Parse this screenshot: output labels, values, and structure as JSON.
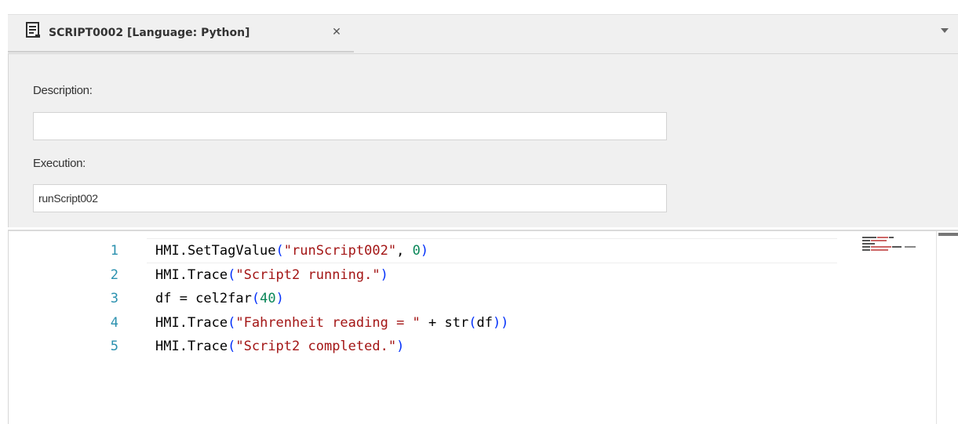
{
  "tab": {
    "title": "SCRIPT0002 [Language: Python]",
    "close_glyph": "✕",
    "icon": "script-document-icon",
    "dropdown_icon": "chevron-down-icon"
  },
  "properties": {
    "description_label": "Description:",
    "description_value": "",
    "execution_label": "Execution:",
    "execution_value": "runScript002"
  },
  "editor": {
    "lines": [
      {
        "number": "1",
        "tokens": [
          {
            "text": "HMI.SetTagValue",
            "kind": "plain"
          },
          {
            "text": "(",
            "kind": "bracket"
          },
          {
            "text": "\"runScript002\"",
            "kind": "str"
          },
          {
            "text": ", ",
            "kind": "plain"
          },
          {
            "text": "0",
            "kind": "num"
          },
          {
            "text": ")",
            "kind": "bracket"
          }
        ]
      },
      {
        "number": "2",
        "tokens": [
          {
            "text": "HMI.Trace",
            "kind": "plain"
          },
          {
            "text": "(",
            "kind": "bracket"
          },
          {
            "text": "\"Script2 running.\"",
            "kind": "str"
          },
          {
            "text": ")",
            "kind": "bracket"
          }
        ]
      },
      {
        "number": "3",
        "tokens": [
          {
            "text": "df = cel2far",
            "kind": "plain"
          },
          {
            "text": "(",
            "kind": "bracket"
          },
          {
            "text": "40",
            "kind": "num"
          },
          {
            "text": ")",
            "kind": "bracket"
          }
        ]
      },
      {
        "number": "4",
        "tokens": [
          {
            "text": "HMI.Trace",
            "kind": "plain"
          },
          {
            "text": "(",
            "kind": "bracket"
          },
          {
            "text": "\"Fahrenheit reading = \"",
            "kind": "str"
          },
          {
            "text": " + str",
            "kind": "plain"
          },
          {
            "text": "(",
            "kind": "bracket"
          },
          {
            "text": "df",
            "kind": "plain"
          },
          {
            "text": "))",
            "kind": "bracket"
          }
        ]
      },
      {
        "number": "5",
        "tokens": [
          {
            "text": "HMI.Trace",
            "kind": "plain"
          },
          {
            "text": "(",
            "kind": "bracket"
          },
          {
            "text": "\"Script2 completed.\"",
            "kind": "str"
          },
          {
            "text": ")",
            "kind": "bracket"
          }
        ]
      }
    ]
  },
  "colors": {
    "line_number": "#2b91af",
    "string": "#a31515",
    "number": "#098658",
    "bracket": "#0431fa",
    "panel_bg": "#f0f0f0"
  }
}
